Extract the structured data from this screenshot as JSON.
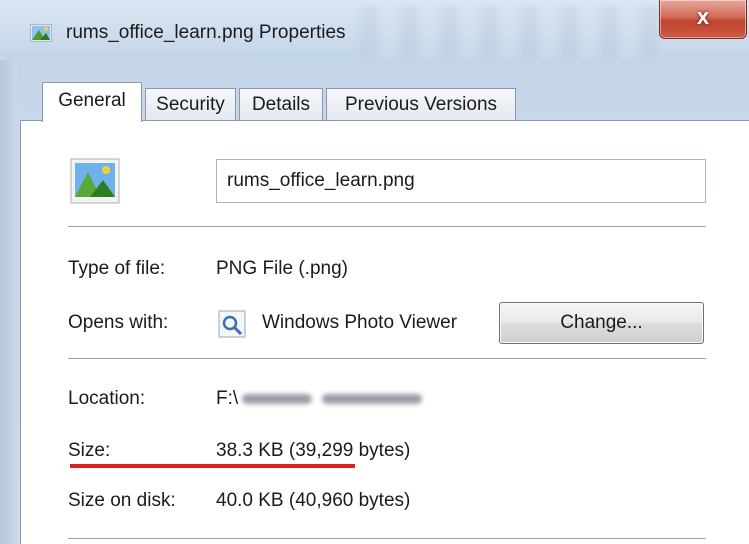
{
  "window": {
    "title": "rums_office_learn.png Properties",
    "close_glyph": "x"
  },
  "tabs": [
    {
      "label": "General",
      "active": true
    },
    {
      "label": "Security",
      "active": false
    },
    {
      "label": "Details",
      "active": false
    },
    {
      "label": "Previous Versions",
      "active": false
    }
  ],
  "file": {
    "name": "rums_office_learn.png",
    "icon": "image-file-icon"
  },
  "type_of_file": {
    "label": "Type of file:",
    "value": "PNG File (.png)"
  },
  "opens_with": {
    "label": "Opens with:",
    "app_icon": "photo-viewer-icon",
    "value": "Windows Photo Viewer",
    "change_label": "Change..."
  },
  "location": {
    "label": "Location:",
    "value_prefix": "F:\\",
    "value_redacted": true
  },
  "size": {
    "label": "Size:",
    "value": "38.3 KB (39,299 bytes)",
    "underline_color": "#e21f1f"
  },
  "size_on_disk": {
    "label": "Size on disk:",
    "value": "40.0 KB (40,960 bytes)"
  }
}
